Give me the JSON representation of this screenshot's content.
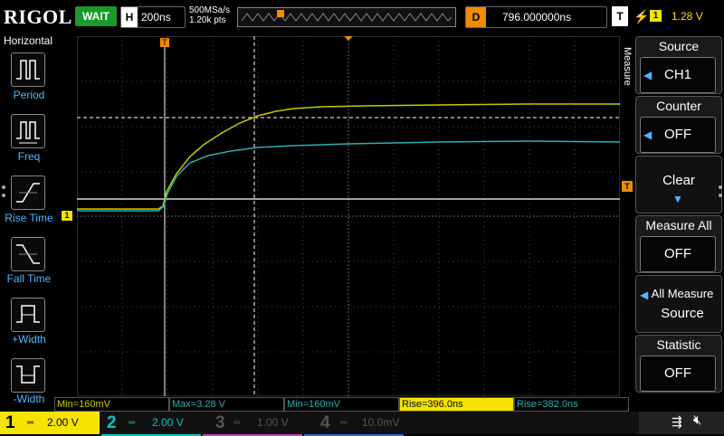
{
  "header": {
    "logo": "RIGOL",
    "status": "WAIT",
    "horizontal": {
      "label": "H",
      "value": "200ns"
    },
    "sample_rate": "500MSa/s",
    "points": "1.20k pts",
    "delay": {
      "label": "D",
      "value": "796.000000ns"
    },
    "trigger": {
      "label": "T",
      "source": "1",
      "level": "1.28 V"
    }
  },
  "sidebar": {
    "title": "Horizontal",
    "items": [
      {
        "label": "Period",
        "icon": "period-icon"
      },
      {
        "label": "Freq",
        "icon": "frequency-icon"
      },
      {
        "label": "Rise Time",
        "icon": "rise-time-icon"
      },
      {
        "label": "Fall Time",
        "icon": "fall-time-icon"
      },
      {
        "label": "+Width",
        "icon": "positive-width-icon"
      },
      {
        "label": "-Width",
        "icon": "negative-width-icon"
      }
    ]
  },
  "menu": {
    "title": "Measure",
    "source": {
      "label": "Source",
      "value": "CH1"
    },
    "counter": {
      "label": "Counter",
      "value": "OFF"
    },
    "clear": {
      "label": "Clear"
    },
    "measure_all": {
      "label": "Measure All",
      "value": "OFF"
    },
    "all_measure_source": {
      "line1": "All Measure",
      "line2": "Source"
    },
    "statistic": {
      "label": "Statistic",
      "value": "OFF"
    }
  },
  "markers": {
    "trigger": "T",
    "ch1": "1"
  },
  "measurements": [
    "Min=160mV",
    "Max=3.28 V",
    "Min=160mV",
    "Rise=396.0ns",
    "Rise=382.0ns"
  ],
  "channels": [
    {
      "num": "1",
      "scale": "2.00 V",
      "color": "#f5e300"
    },
    {
      "num": "2",
      "scale": "2.00 V",
      "color": "#00c8c8"
    },
    {
      "num": "3",
      "scale": "1.00 V",
      "color": "#c040c0"
    },
    {
      "num": "4",
      "scale": "10.0mV",
      "color": "#2a6ad0"
    }
  ],
  "colors": {
    "ch1": "#c8c800",
    "ch2": "#2ab0b0",
    "status_bg": "#1a9a2a",
    "accent": "#f08c00"
  }
}
